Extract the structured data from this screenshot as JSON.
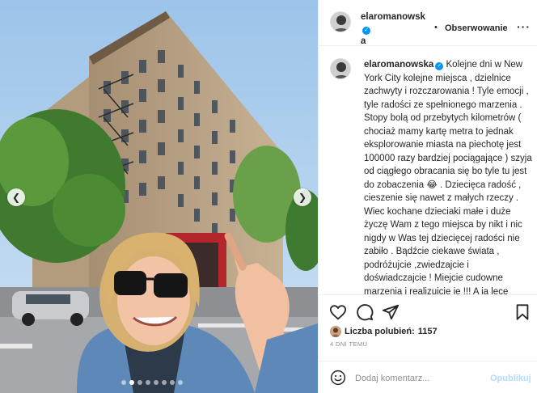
{
  "post": {
    "username_line1": "elaromanowsk",
    "username_line2": "a",
    "separator": "•",
    "follow_label": "Obserwowanie",
    "more_label": "···"
  },
  "caption": {
    "username": "elaromanowska",
    "text": "Kolejne dni w New York City kolejne miejsca , dzielnice zachwyty i rozczarowania ! Tyle emocji , tyle radości ze spełnionego marzenia . Stopy bolą od przebytych kilometrów ( chociaż mamy kartę metra to jednak eksplorowanie miasta na piechotę jest 100000 razy bardziej pociągające ) szyja od ciągłego obracania się bo tyle tu jest do zobaczenia 😂 . Dziecięca radość , cieszenie się nawet z małych rzeczy . Wiec kochane dzieciaki małe i duże życzę Wam z tego miejsca by nikt i nic nigdy w Was tej dziecięcej radości nie zabiło . Bądźcie ciekawe świata , podróżujcie ,zwiedzajcie i doświadczajcie ! Miejcie cudowne marzenia i realizujcie je !!! A ja lecę uczcić ten dzień dziecka z cudowna , madra i piekielnie zdolna"
  },
  "engagement": {
    "likes_label": "Liczba polubień:",
    "likes_count": "1157",
    "time_ago": "4 DNI TEMU"
  },
  "comment_box": {
    "placeholder": "Dodaj komentarz...",
    "publish_label": "Opublikuj"
  },
  "carousel": {
    "prev_icon": "chevron-left-icon",
    "next_icon": "chevron-right-icon",
    "dot_count": 8,
    "active_dot": 1
  },
  "icons": {
    "like": "heart-icon",
    "comment": "comment-icon",
    "share": "send-icon",
    "save": "bookmark-icon",
    "emoji": "smiley-icon",
    "verified": "verified-badge-icon"
  },
  "colors": {
    "verified": "#0095f6",
    "publish_disabled": "#b3dbff",
    "muted": "#8e8e8e",
    "text": "#262626"
  }
}
